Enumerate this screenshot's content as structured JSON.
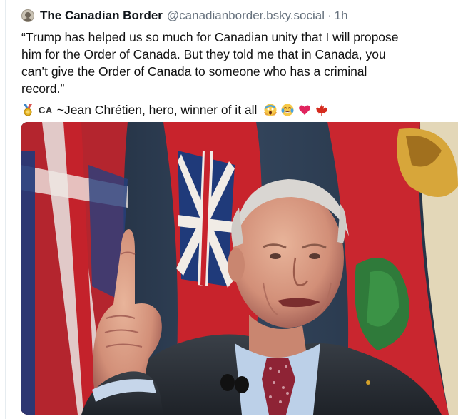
{
  "post": {
    "author_name": "The Canadian Border",
    "author_handle": "@canadianborder.bsky.social",
    "separator": "·",
    "timestamp": "1h",
    "text_lines": [
      "“Trump has helped us so much for Canadian unity that I will propose",
      "him for the Order of Canada. But they told me that in Canada, you",
      "can’t give the Order of Canada to someone who has a criminal",
      "record.”"
    ],
    "country_code": "CA",
    "signature": "~Jean Chrétien, hero, winner of it all",
    "icons": {
      "avatar": "account-avatar",
      "medal": "medal-icon",
      "reactions": [
        "scream-emoji-icon",
        "laughing-tears-emoji-icon",
        "red-heart-icon",
        "maple-leaf-icon"
      ]
    },
    "image": {
      "subject": "Jean Chrétien pointing finger upward in front of flags"
    }
  },
  "colors": {
    "handle": "#66717d",
    "text": "#111111",
    "heart": "#e0245e",
    "maple": "#d52b1e"
  }
}
